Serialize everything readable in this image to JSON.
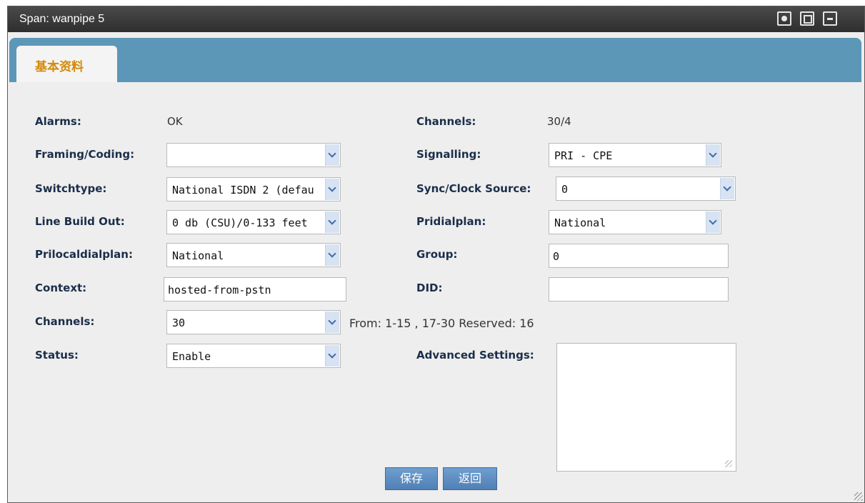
{
  "window": {
    "title": "Span: wanpipe  5"
  },
  "tabs": [
    {
      "label": "基本资料"
    }
  ],
  "form": {
    "alarms": {
      "label": "Alarms:",
      "value": "OK"
    },
    "framing": {
      "label": "Framing/Coding:",
      "value": ""
    },
    "switchtype": {
      "label": "Switchtype:",
      "value": "National ISDN 2 (defau"
    },
    "line_build_out": {
      "label": "Line Build Out:",
      "value": "0 db (CSU)/0-133 feet"
    },
    "prilocaldialplan": {
      "label": "Prilocaldialplan:",
      "value": "National"
    },
    "context": {
      "label": "Context:",
      "value": "hosted-from-pstn"
    },
    "channels_select": {
      "label": "Channels:",
      "value": "30",
      "note": "From: 1-15 , 17-30 Reserved: 16"
    },
    "status": {
      "label": "Status:",
      "value": "Enable"
    },
    "channels_info": {
      "label": "Channels:",
      "value": "30/4"
    },
    "signalling": {
      "label": "Signalling:",
      "value": "PRI - CPE"
    },
    "sync_clock": {
      "label": "Sync/Clock Source:",
      "value": "0"
    },
    "pridialplan": {
      "label": "Pridialplan:",
      "value": "National"
    },
    "group": {
      "label": "Group:",
      "value": "0"
    },
    "did": {
      "label": "DID:",
      "value": ""
    },
    "advanced": {
      "label": "Advanced Settings:",
      "value": ""
    }
  },
  "buttons": {
    "save": "保存",
    "back": "返回"
  },
  "icons": [
    "window-option-icon",
    "maximize-icon",
    "minimize-icon",
    "resize-grip-icon"
  ],
  "colors": {
    "title_bar": "#3a3a3a",
    "tab_bar": "#5c97b8",
    "tab_text": "#d38a08",
    "button": "#5a8ac0"
  }
}
